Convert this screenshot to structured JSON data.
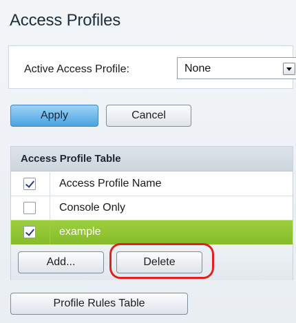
{
  "page": {
    "title": "Access Profiles"
  },
  "active_profile": {
    "label": "Active Access Profile:",
    "selected": "None"
  },
  "actions": {
    "apply": "Apply",
    "cancel": "Cancel"
  },
  "table": {
    "title": "Access Profile Table",
    "column_header": "Access Profile Name",
    "header_checked": true,
    "rows": [
      {
        "name": "Console Only",
        "checked": false,
        "selected": false
      },
      {
        "name": "example",
        "checked": true,
        "selected": true
      }
    ],
    "buttons": {
      "add": "Add...",
      "delete": "Delete"
    }
  },
  "footer": {
    "rules_button": "Profile Rules Table"
  },
  "colors": {
    "selected_row": "#92c636",
    "apply_button": "#4aa3e0",
    "highlight": "#e0211d"
  }
}
